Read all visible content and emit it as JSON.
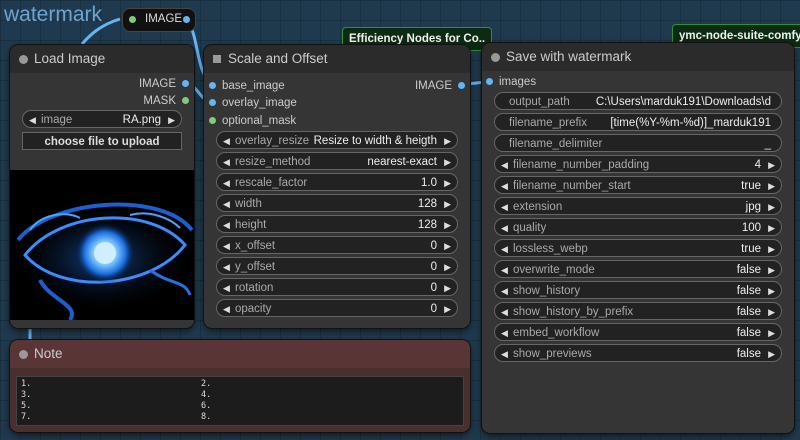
{
  "group": {
    "title": "watermark"
  },
  "floating_output": {
    "label": "IMAGE"
  },
  "badges": {
    "efficiency": "Efficiency Nodes for Co..",
    "ymc": "ymc-node-suite-comfyui"
  },
  "load_image": {
    "title": "Load Image",
    "outputs": [
      "IMAGE",
      "MASK"
    ],
    "image_widget": {
      "label": "image",
      "value": "RA.png"
    },
    "upload_label": "choose file to upload"
  },
  "scale_offset": {
    "title": "Scale and Offset",
    "inputs": [
      "base_image",
      "overlay_image",
      "optional_mask"
    ],
    "output": "IMAGE",
    "widgets": [
      {
        "label": "overlay_resize",
        "value": "Resize to width & heigth"
      },
      {
        "label": "resize_method",
        "value": "nearest-exact"
      },
      {
        "label": "rescale_factor",
        "value": "1.0"
      },
      {
        "label": "width",
        "value": "128"
      },
      {
        "label": "height",
        "value": "128"
      },
      {
        "label": "x_offset",
        "value": "0"
      },
      {
        "label": "y_offset",
        "value": "0"
      },
      {
        "label": "rotation",
        "value": "0"
      },
      {
        "label": "opacity",
        "value": "0"
      }
    ]
  },
  "save_watermark": {
    "title": "Save with watermark",
    "input": "images",
    "text_widgets": [
      {
        "label": "output_path",
        "value": "C:\\Users\\marduk191\\Downloads\\d"
      },
      {
        "label": "filename_prefix",
        "value": "[time(%Y-%m-%d)]_marduk191"
      },
      {
        "label": "filename_delimiter",
        "value": "_"
      }
    ],
    "widgets": [
      {
        "label": "filename_number_padding",
        "value": "4"
      },
      {
        "label": "filename_number_start",
        "value": "true"
      },
      {
        "label": "extension",
        "value": "jpg"
      },
      {
        "label": "quality",
        "value": "100"
      },
      {
        "label": "lossless_webp",
        "value": "true"
      },
      {
        "label": "overwrite_mode",
        "value": "false"
      },
      {
        "label": "show_history",
        "value": "false"
      },
      {
        "label": "show_history_by_prefix",
        "value": "false"
      },
      {
        "label": "embed_workflow",
        "value": "false"
      },
      {
        "label": "show_previews",
        "value": "false"
      }
    ]
  },
  "note": {
    "title": "Note",
    "lines": [
      "1.",
      "2.",
      "3.",
      "4.",
      "5.",
      "6.",
      "7.",
      "8."
    ]
  },
  "colors": {
    "canvas": "#1f3a4e",
    "node_body": "#353535",
    "note_body": "#4a2f2f",
    "image_pin": "#64b5f6",
    "mask_pin": "#7ccc7c",
    "badge_border": "#2f8f3b"
  }
}
